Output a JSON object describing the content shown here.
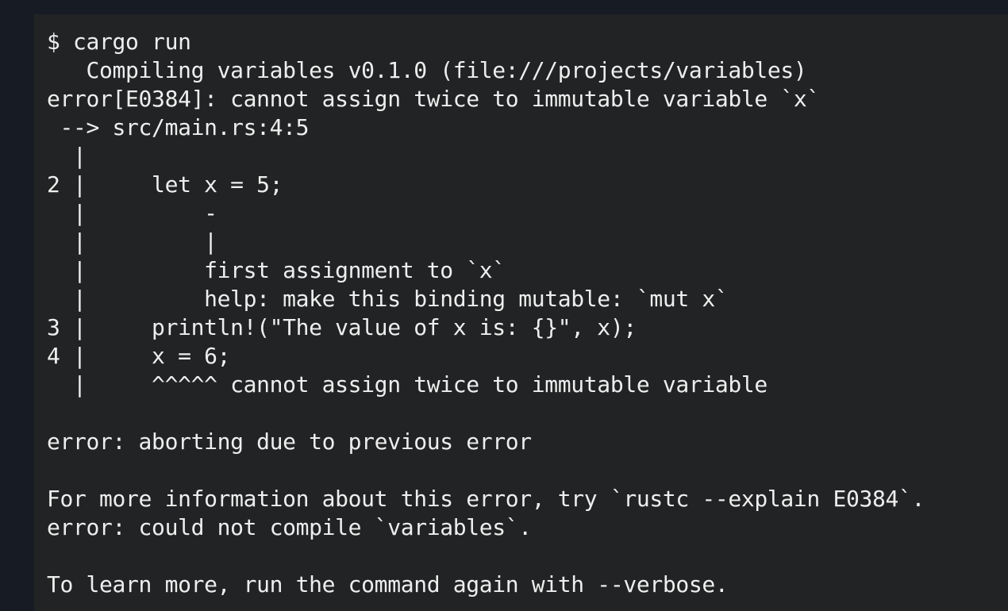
{
  "terminal": {
    "lines": [
      "$ cargo run",
      "   Compiling variables v0.1.0 (file:///projects/variables)",
      "error[E0384]: cannot assign twice to immutable variable `x`",
      " --> src/main.rs:4:5",
      "  |",
      "2 |     let x = 5;",
      "  |         -",
      "  |         |",
      "  |         first assignment to `x`",
      "  |         help: make this binding mutable: `mut x`",
      "3 |     println!(\"The value of x is: {}\", x);",
      "4 |     x = 6;",
      "  |     ^^^^^ cannot assign twice to immutable variable",
      "",
      "error: aborting due to previous error",
      "",
      "For more information about this error, try `rustc --explain E0384`.",
      "error: could not compile `variables`.",
      "",
      "To learn more, run the command again with --verbose."
    ]
  }
}
